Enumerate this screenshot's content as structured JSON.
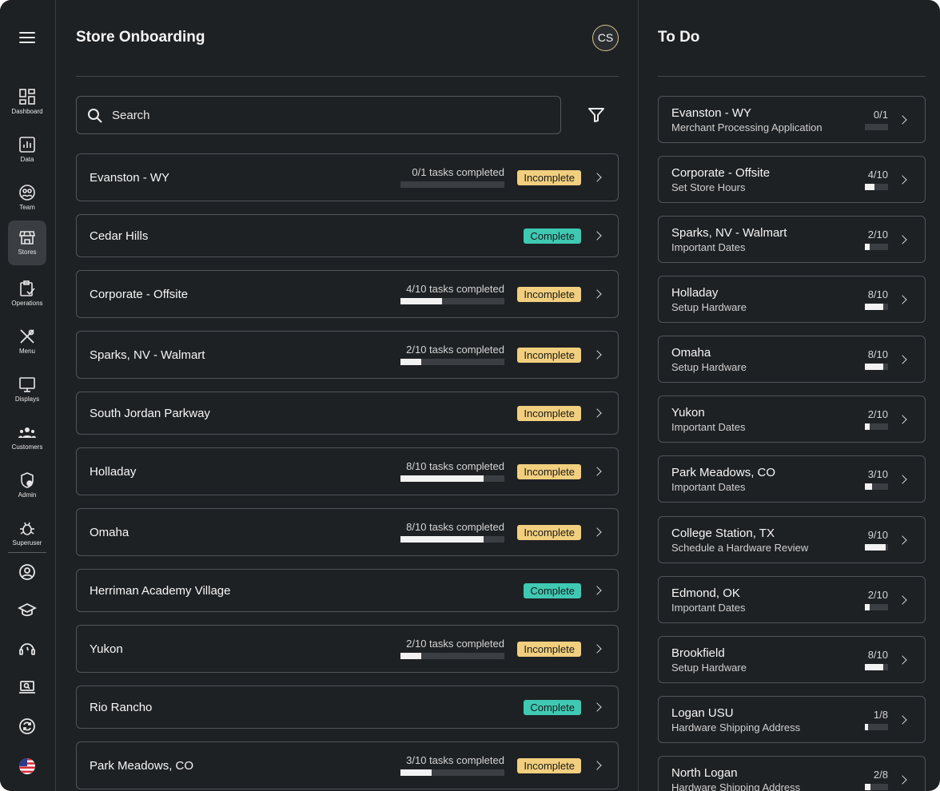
{
  "app": {
    "title": "Store Onboarding",
    "avatar_initials": "CS",
    "accent": "#f1cf7e",
    "complete_color": "#3fc9b3"
  },
  "sidebar": {
    "menu_icon": "hamburger-icon",
    "items": [
      {
        "label": "Dashboard",
        "icon": "dashboard-icon"
      },
      {
        "label": "Data",
        "icon": "bar-chart-icon"
      },
      {
        "label": "Team",
        "icon": "team-icon"
      },
      {
        "label": "Stores",
        "icon": "store-icon",
        "active": true
      },
      {
        "label": "Operations",
        "icon": "clipboard-check-icon"
      },
      {
        "label": "Menu",
        "icon": "utensils-icon"
      },
      {
        "label": "Displays",
        "icon": "monitor-icon"
      },
      {
        "label": "Customers",
        "icon": "customers-icon"
      },
      {
        "label": "Admin",
        "icon": "shield-user-icon"
      },
      {
        "label": "Superuser",
        "icon": "bug-icon"
      }
    ],
    "bottom_icons": [
      "account-icon",
      "graduation-cap-icon",
      "support-headset-icon",
      "laptop-icon",
      "sync-icon",
      "us-flag-icon"
    ]
  },
  "search": {
    "placeholder": "Search"
  },
  "stores": [
    {
      "name": "Evanston - WY",
      "tasks": "0/1 tasks completed",
      "progress": 0.0,
      "status": "Incomplete"
    },
    {
      "name": "Cedar Hills",
      "tasks": "",
      "progress": null,
      "status": "Complete"
    },
    {
      "name": "Corporate - Offsite",
      "tasks": "4/10 tasks completed",
      "progress": 0.4,
      "status": "Incomplete"
    },
    {
      "name": "Sparks, NV - Walmart",
      "tasks": "2/10 tasks completed",
      "progress": 0.2,
      "status": "Incomplete"
    },
    {
      "name": "South Jordan Parkway",
      "tasks": "",
      "progress": null,
      "status": "Incomplete"
    },
    {
      "name": "Holladay",
      "tasks": "8/10 tasks completed",
      "progress": 0.8,
      "status": "Incomplete"
    },
    {
      "name": "Omaha",
      "tasks": "8/10 tasks completed",
      "progress": 0.8,
      "status": "Incomplete"
    },
    {
      "name": "Herriman Academy Village",
      "tasks": "",
      "progress": null,
      "status": "Complete"
    },
    {
      "name": "Yukon",
      "tasks": "2/10 tasks completed",
      "progress": 0.2,
      "status": "Incomplete"
    },
    {
      "name": "Rio Rancho",
      "tasks": "",
      "progress": null,
      "status": "Complete"
    },
    {
      "name": "Park Meadows, CO",
      "tasks": "3/10 tasks completed",
      "progress": 0.3,
      "status": "Incomplete"
    }
  ],
  "todo": {
    "title": "To Do",
    "items": [
      {
        "store": "Evanston - WY",
        "task": "Merchant Processing Application",
        "count": "0/1",
        "progress": 0.0
      },
      {
        "store": "Corporate - Offsite",
        "task": "Set Store Hours",
        "count": "4/10",
        "progress": 0.4
      },
      {
        "store": "Sparks, NV - Walmart",
        "task": "Important Dates",
        "count": "2/10",
        "progress": 0.2
      },
      {
        "store": "Holladay",
        "task": "Setup Hardware",
        "count": "8/10",
        "progress": 0.8
      },
      {
        "store": "Omaha",
        "task": "Setup Hardware",
        "count": "8/10",
        "progress": 0.8
      },
      {
        "store": "Yukon",
        "task": "Important Dates",
        "count": "2/10",
        "progress": 0.2
      },
      {
        "store": "Park Meadows, CO",
        "task": "Important Dates",
        "count": "3/10",
        "progress": 0.3
      },
      {
        "store": "College Station, TX",
        "task": "Schedule a Hardware Review",
        "count": "9/10",
        "progress": 0.9
      },
      {
        "store": "Edmond, OK",
        "task": "Important Dates",
        "count": "2/10",
        "progress": 0.2
      },
      {
        "store": "Brookfield",
        "task": "Setup Hardware",
        "count": "8/10",
        "progress": 0.8
      },
      {
        "store": "Logan USU",
        "task": "Hardware Shipping Address",
        "count": "1/8",
        "progress": 0.125
      },
      {
        "store": "North Logan",
        "task": "Hardware Shipping Address",
        "count": "2/8",
        "progress": 0.25
      }
    ]
  }
}
